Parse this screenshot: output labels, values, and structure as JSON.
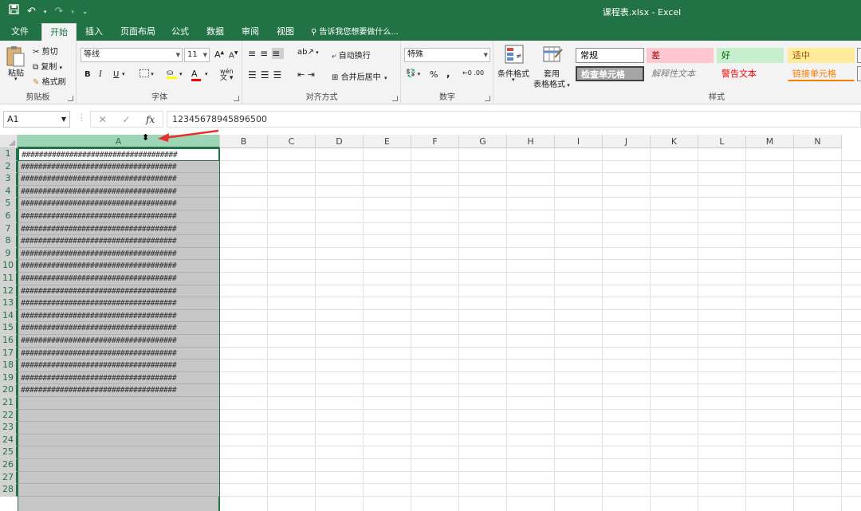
{
  "window": {
    "title": "课程表.xlsx - Excel"
  },
  "qat": {
    "save_icon": "save-icon",
    "undo_icon": "undo-icon",
    "redo_icon": "redo-icon",
    "customize_icon": "customize-qat-icon"
  },
  "tabs": [
    {
      "label": "文件",
      "active": false
    },
    {
      "label": "开始",
      "active": true
    },
    {
      "label": "插入",
      "active": false
    },
    {
      "label": "页面布局",
      "active": false
    },
    {
      "label": "公式",
      "active": false
    },
    {
      "label": "数据",
      "active": false
    },
    {
      "label": "审阅",
      "active": false
    },
    {
      "label": "视图",
      "active": false
    }
  ],
  "tell_me": "告诉我您想要做什么...",
  "ribbon": {
    "clipboard": {
      "group": "剪贴板",
      "paste": "粘贴",
      "cut": "剪切",
      "copy": "复制",
      "format_painter": "格式刷"
    },
    "font": {
      "group": "字体",
      "font_name": "等线",
      "font_size": "11",
      "bold": "B",
      "italic": "I",
      "underline": "U",
      "increase": "A",
      "decrease": "A",
      "font_color": "A",
      "phonetic": "wén"
    },
    "alignment": {
      "group": "对齐方式",
      "wrap": "自动换行",
      "merge": "合并后居中"
    },
    "number": {
      "group": "数字",
      "format": "特殊",
      "percent": "%",
      "comma": ","
    },
    "styles_cmds": {
      "conditional": "条件格式",
      "table1": "套用",
      "table2": "表格格式"
    },
    "styles": {
      "group": "样式",
      "cells": [
        {
          "label": "常规",
          "bg": "#ffffff",
          "color": "#000000"
        },
        {
          "label": "差",
          "bg": "#ffc7ce",
          "color": "#9c0006"
        },
        {
          "label": "好",
          "bg": "#c6efce",
          "color": "#006100"
        },
        {
          "label": "适中",
          "bg": "#ffeb9c",
          "color": "#9c5700"
        },
        {
          "label": "检查单元格",
          "bg": "#a5a5a5",
          "color": "#ffffff"
        },
        {
          "label": "解释性文本",
          "bg": "#f3f3f3",
          "color": "#7f7f7f"
        },
        {
          "label": "警告文本",
          "bg": "#f3f3f3",
          "color": "#ff0000"
        },
        {
          "label": "链接单元格",
          "bg": "#f3f3f3",
          "color": "#fa7d00"
        }
      ]
    }
  },
  "formula_bar": {
    "name_box": "A1",
    "cancel": "✕",
    "enter": "✓",
    "fx": "fx",
    "content": "12345678945896500"
  },
  "sheet": {
    "columns": [
      "A",
      "B",
      "C",
      "D",
      "E",
      "F",
      "G",
      "H",
      "I",
      "J",
      "K",
      "L",
      "M",
      "N"
    ],
    "rows": [
      "1",
      "2",
      "3",
      "4",
      "5",
      "6",
      "7",
      "8",
      "9",
      "10",
      "11",
      "12",
      "13",
      "14",
      "15",
      "16",
      "17",
      "18",
      "19",
      "20",
      "21",
      "22",
      "23",
      "24",
      "25",
      "26",
      "27",
      "28"
    ],
    "a_values": [
      "####################################",
      "####################################",
      "####################################",
      "####################################",
      "####################################",
      "####################################",
      "####################################",
      "####################################",
      "####################################",
      "####################################",
      "####################################",
      "####################################",
      "####################################",
      "####################################",
      "####################################",
      "####################################",
      "####################################",
      "####################################",
      "####################################",
      "####################################"
    ],
    "selected_column": "A",
    "accent": "#217346"
  },
  "annotation": {
    "arrow_color": "#e8302a",
    "cursor_icon": "resize-cursor-icon"
  }
}
